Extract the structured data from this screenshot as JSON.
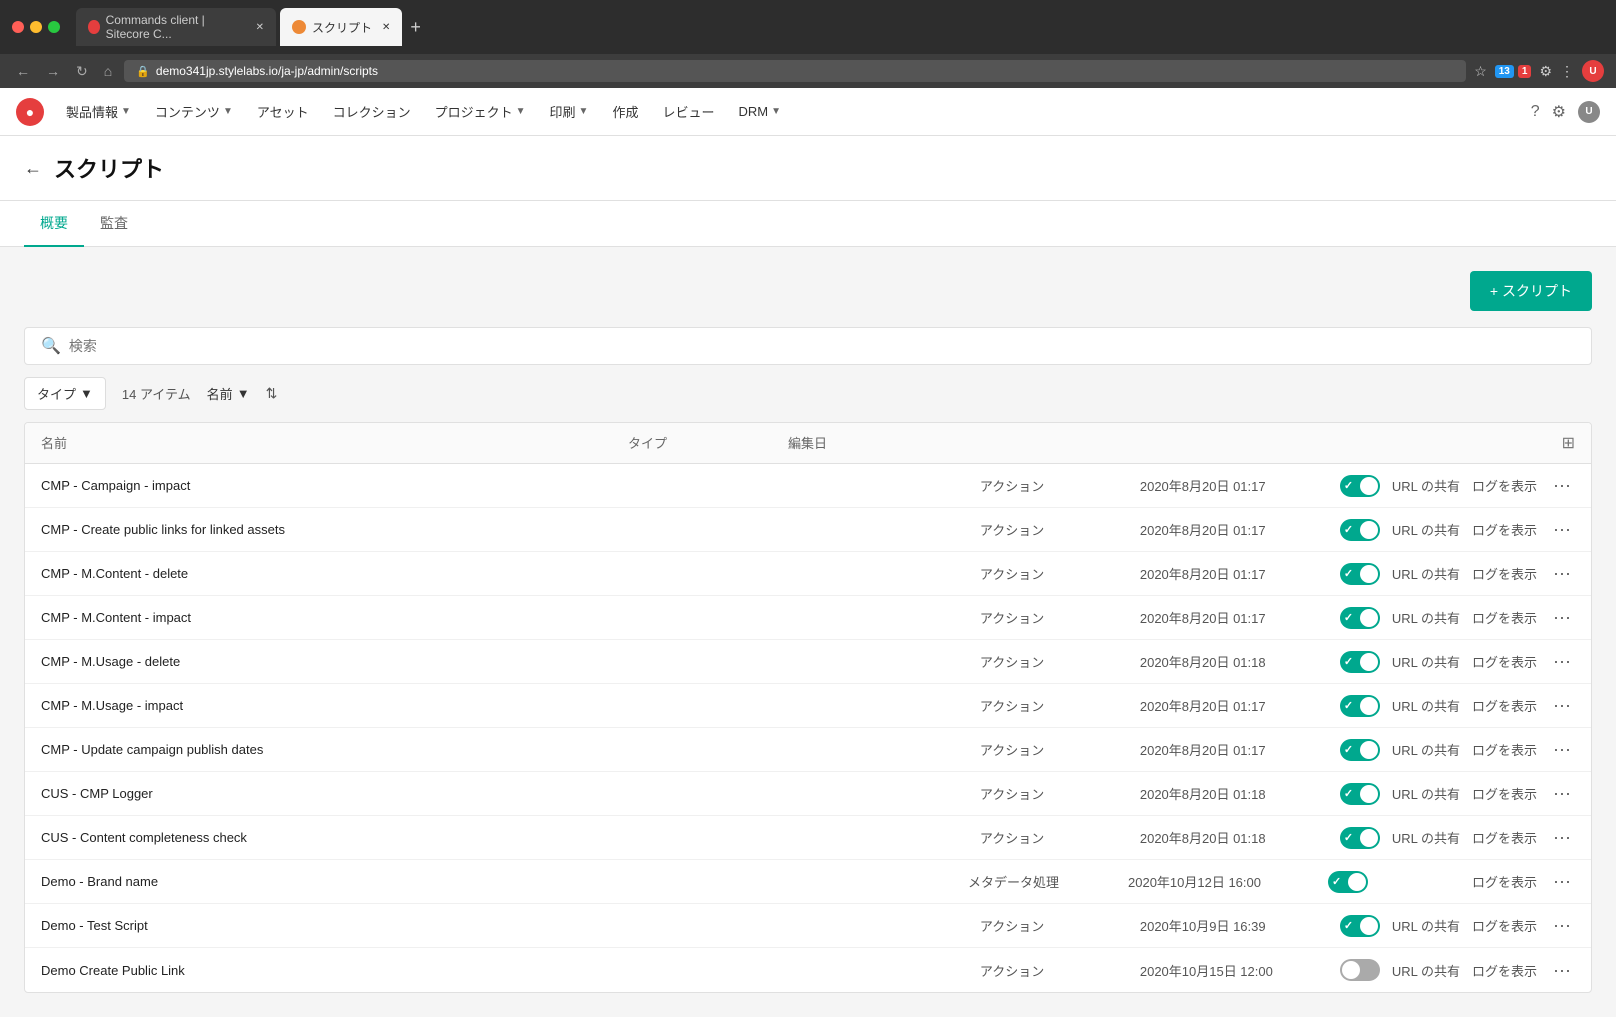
{
  "browser": {
    "tabs": [
      {
        "id": "tab1",
        "label": "Commands client | Sitecore C...",
        "favicon": "red",
        "active": false
      },
      {
        "id": "tab2",
        "label": "スクリプト",
        "favicon": "orange",
        "active": true
      }
    ],
    "url": "demo341jp.stylelabs.io/ja-jp/admin/scripts",
    "add_tab_label": "+"
  },
  "header": {
    "logo": "●",
    "nav_items": [
      {
        "label": "製品情報",
        "has_dropdown": true
      },
      {
        "label": "コンテンツ",
        "has_dropdown": true
      },
      {
        "label": "アセット",
        "has_dropdown": false
      },
      {
        "label": "コレクション",
        "has_dropdown": false
      },
      {
        "label": "プロジェクト",
        "has_dropdown": true
      },
      {
        "label": "印刷",
        "has_dropdown": true
      },
      {
        "label": "作成",
        "has_dropdown": false
      },
      {
        "label": "レビュー",
        "has_dropdown": false
      },
      {
        "label": "DRM",
        "has_dropdown": true
      }
    ]
  },
  "page": {
    "back_label": "←",
    "title": "スクリプト",
    "tabs": [
      {
        "id": "overview",
        "label": "概要",
        "active": true
      },
      {
        "id": "audit",
        "label": "監査",
        "active": false
      }
    ]
  },
  "toolbar": {
    "add_script_label": "+ スクリプト"
  },
  "search": {
    "placeholder": "検索"
  },
  "filters": {
    "type_label": "タイプ",
    "type_chevron": "▼",
    "count_label": "14 アイテム",
    "name_label": "名前",
    "name_chevron": "▼",
    "sort_icon": "⇅"
  },
  "table": {
    "columns": [
      {
        "id": "name",
        "label": "名前"
      },
      {
        "id": "type",
        "label": "タイプ"
      },
      {
        "id": "date",
        "label": "編集日"
      }
    ],
    "rows": [
      {
        "name": "CMP - Campaign - impact",
        "type": "アクション",
        "date": "2020年8月20日 01:17",
        "toggle": "on",
        "url_share": "URL の共有",
        "log_view": "ログを表示"
      },
      {
        "name": "CMP - Create public links for linked assets",
        "type": "アクション",
        "date": "2020年8月20日 01:17",
        "toggle": "on",
        "url_share": "URL の共有",
        "log_view": "ログを表示"
      },
      {
        "name": "CMP - M.Content - delete",
        "type": "アクション",
        "date": "2020年8月20日 01:17",
        "toggle": "on",
        "url_share": "URL の共有",
        "log_view": "ログを表示"
      },
      {
        "name": "CMP - M.Content - impact",
        "type": "アクション",
        "date": "2020年8月20日 01:17",
        "toggle": "on",
        "url_share": "URL の共有",
        "log_view": "ログを表示"
      },
      {
        "name": "CMP - M.Usage - delete",
        "type": "アクション",
        "date": "2020年8月20日 01:18",
        "toggle": "on",
        "url_share": "URL の共有",
        "log_view": "ログを表示"
      },
      {
        "name": "CMP - M.Usage - impact",
        "type": "アクション",
        "date": "2020年8月20日 01:17",
        "toggle": "on",
        "url_share": "URL の共有",
        "log_view": "ログを表示"
      },
      {
        "name": "CMP - Update campaign publish dates",
        "type": "アクション",
        "date": "2020年8月20日 01:17",
        "toggle": "on",
        "url_share": "URL の共有",
        "log_view": "ログを表示"
      },
      {
        "name": "CUS - CMP Logger",
        "type": "アクション",
        "date": "2020年8月20日 01:18",
        "toggle": "on",
        "url_share": "URL の共有",
        "log_view": "ログを表示"
      },
      {
        "name": "CUS - Content completeness check",
        "type": "アクション",
        "date": "2020年8月20日 01:18",
        "toggle": "on",
        "url_share": "URL の共有",
        "log_view": "ログを表示"
      },
      {
        "name": "Demo - Brand name",
        "type": "メタデータ処理",
        "date": "2020年10月12日 16:00",
        "toggle": "on",
        "url_share": null,
        "log_view": "ログを表示"
      },
      {
        "name": "Demo - Test Script",
        "type": "アクション",
        "date": "2020年10月9日 16:39",
        "toggle": "on",
        "url_share": "URL の共有",
        "log_view": "ログを表示"
      },
      {
        "name": "Demo Create Public Link",
        "type": "アクション",
        "date": "2020年10月15日 12:00",
        "toggle": "off",
        "url_share": "URL の共有",
        "log_view": "ログを表示"
      }
    ]
  }
}
